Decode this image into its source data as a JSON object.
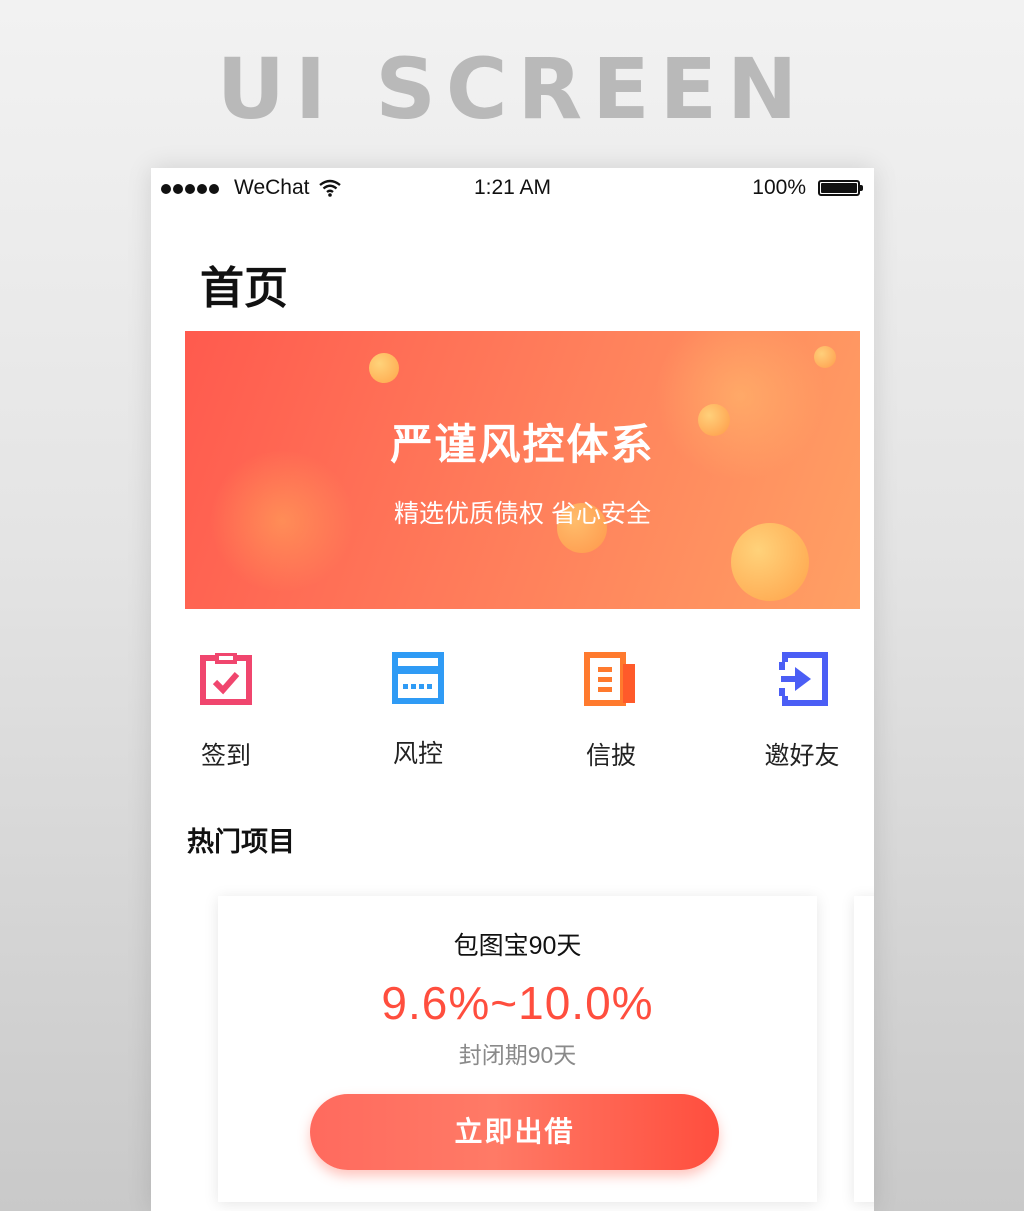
{
  "header_title": "UI SCREEN",
  "status_bar": {
    "carrier": "WeChat",
    "time": "1:21 AM",
    "battery": "100%"
  },
  "page": {
    "title": "首页"
  },
  "banner": {
    "title": "严谨风控体系",
    "subtitle": "精选优质债权 省心安全"
  },
  "actions": [
    {
      "label": "签到",
      "icon": "calendar-check-icon",
      "color": "#f0466e"
    },
    {
      "label": "风控",
      "icon": "card-icon",
      "color": "#2f9bf5"
    },
    {
      "label": "信披",
      "icon": "document-icon",
      "color": "#ff7a2e"
    },
    {
      "label": "邀好友",
      "icon": "invite-arrow-icon",
      "color": "#4b5ef5"
    }
  ],
  "hot_section": {
    "title": "热门项目"
  },
  "product": {
    "name": "包图宝90天",
    "rate": "9.6%~10.0%",
    "term": "封闭期90天",
    "button_label": "立即出借"
  },
  "colors": {
    "accent": "#ff4e3e",
    "banner_start": "#ff5a4e",
    "banner_end": "#ffa064"
  }
}
